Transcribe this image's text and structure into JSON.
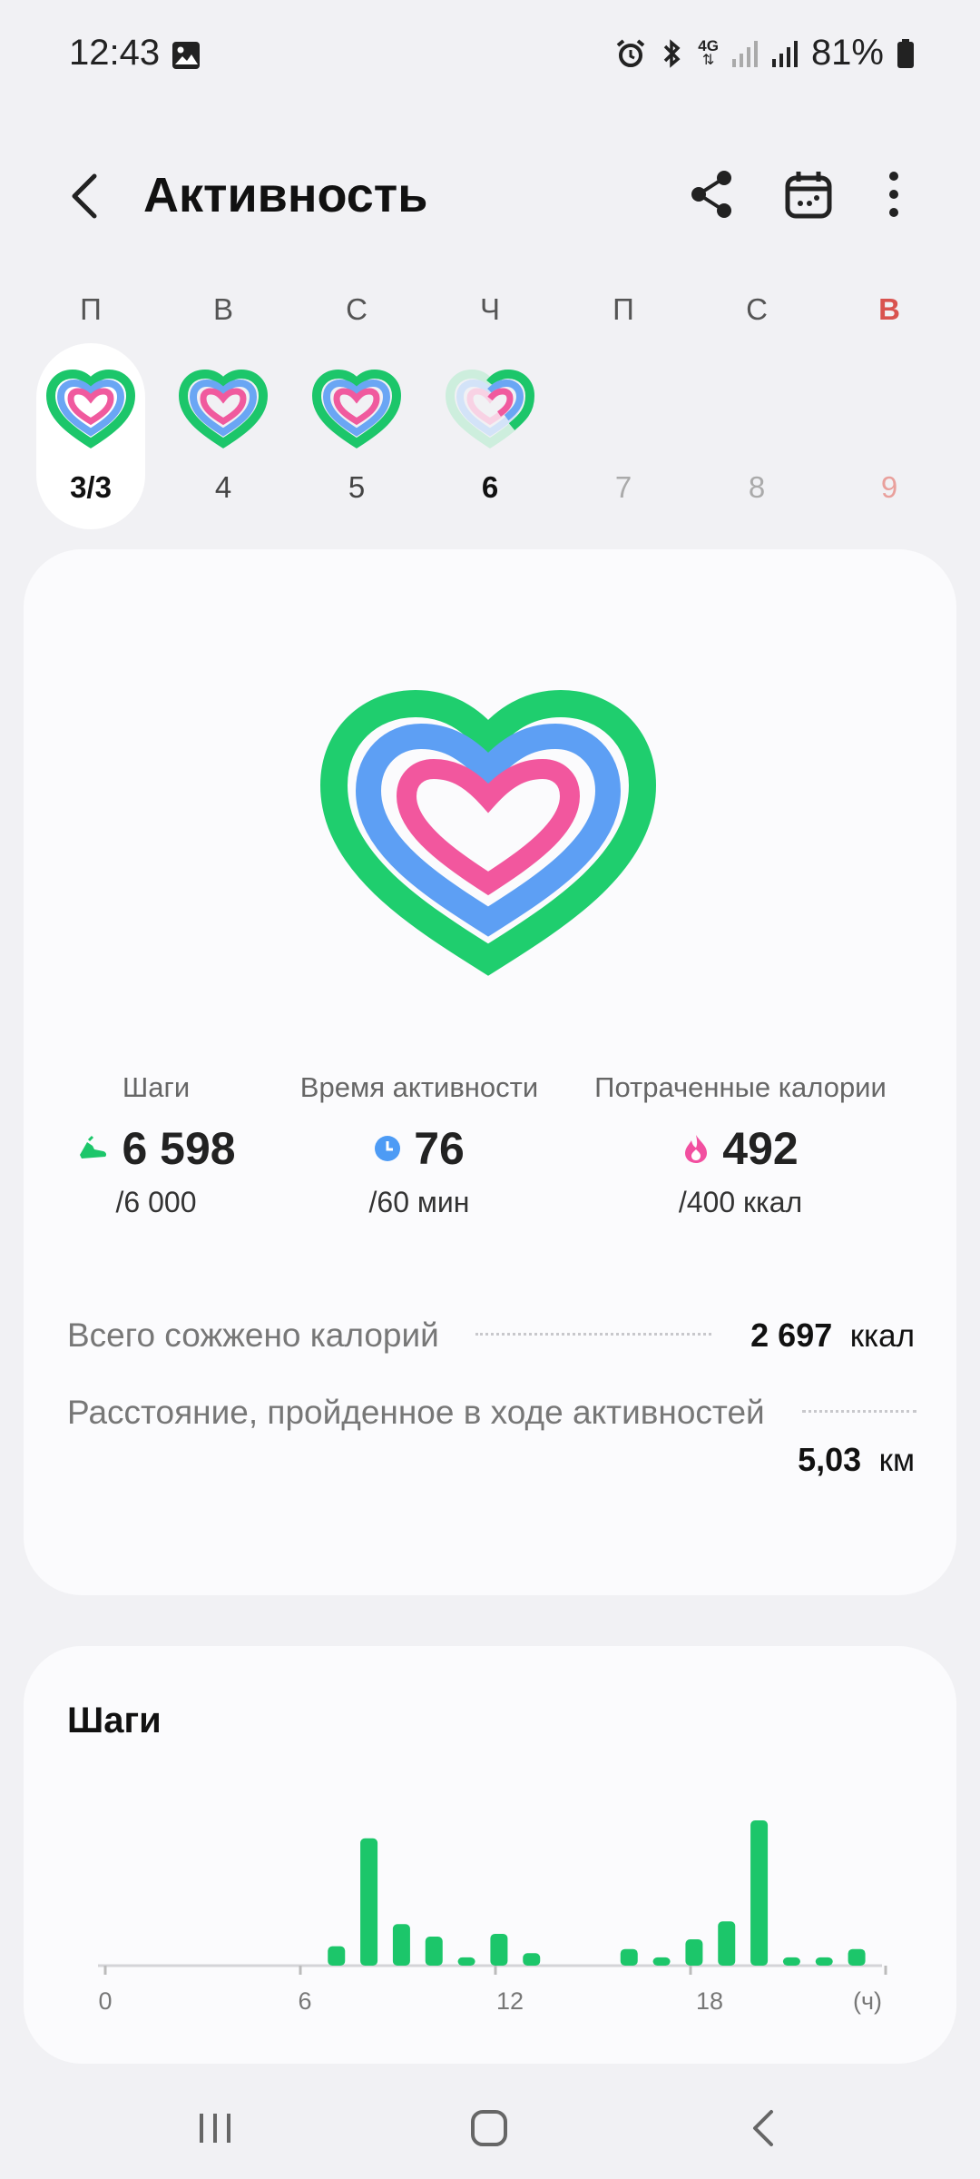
{
  "status_bar": {
    "time": "12:43",
    "network": "4G",
    "battery": "81%",
    "icons": [
      "image-icon",
      "alarm-icon",
      "bluetooth-icon",
      "signal-icon",
      "battery-icon"
    ]
  },
  "header": {
    "title": "Активность",
    "icons": [
      "back-arrow-icon",
      "share-icon",
      "calendar-icon",
      "more-vertical-icon"
    ]
  },
  "week": {
    "days": [
      {
        "letter": "П",
        "number": "3/3",
        "ring": "full",
        "selected": true,
        "weekend": false,
        "future": false
      },
      {
        "letter": "В",
        "number": "4",
        "ring": "full",
        "selected": false,
        "weekend": false,
        "future": false
      },
      {
        "letter": "С",
        "number": "5",
        "ring": "full",
        "selected": false,
        "weekend": false,
        "future": false
      },
      {
        "letter": "Ч",
        "number": "6",
        "ring": "partial",
        "selected": false,
        "weekend": false,
        "future": false,
        "today": true
      },
      {
        "letter": "П",
        "number": "7",
        "ring": "none",
        "selected": false,
        "weekend": false,
        "future": true
      },
      {
        "letter": "С",
        "number": "8",
        "ring": "none",
        "selected": false,
        "weekend": false,
        "future": true
      },
      {
        "letter": "В",
        "number": "9",
        "ring": "none",
        "selected": false,
        "weekend": true,
        "future": true
      }
    ]
  },
  "activity": {
    "metrics": [
      {
        "label": "Шаги",
        "value": "6 598",
        "goal": "/6 000",
        "icon": "shoe-icon",
        "color": "#1cc66a"
      },
      {
        "label": "Время активности",
        "value": "76",
        "goal": "/60 мин",
        "icon": "clock-icon",
        "color": "#4d9bf5"
      },
      {
        "label": "Потраченные калории",
        "value": "492",
        "goal": "/400 ккал",
        "icon": "flame-icon",
        "color": "#f24fa0"
      }
    ],
    "total_calories": {
      "label": "Всего сожжено калорий",
      "value": "2 697",
      "unit": "ккал"
    },
    "distance": {
      "label": "Расстояние, пройденное в ходе активностей",
      "value": "5,03",
      "unit": "км"
    }
  },
  "steps_card": {
    "title": "Шаги",
    "x_ticks": [
      "0",
      "6",
      "12",
      "18",
      "(ч)"
    ]
  },
  "colors": {
    "green": "#1cc66a",
    "blue": "#5aa2f5",
    "pink": "#f05a9e",
    "weekend": "#d9534f"
  },
  "chart_data": {
    "type": "bar",
    "x": [
      7,
      8,
      9,
      10,
      11,
      12,
      13,
      16,
      17,
      18,
      19,
      20,
      21,
      22,
      23
    ],
    "values": [
      14,
      92,
      30,
      21,
      6,
      23,
      9,
      12,
      6,
      19,
      32,
      105,
      6,
      6,
      12
    ],
    "xlabel": "(ч)",
    "xlim": [
      0,
      24
    ],
    "xticks": [
      0,
      6,
      12,
      18
    ],
    "color": "#1cc66a",
    "grid": false
  },
  "nav_bar": {
    "icons": [
      "recent-apps-icon",
      "home-icon",
      "nav-back-icon"
    ]
  }
}
